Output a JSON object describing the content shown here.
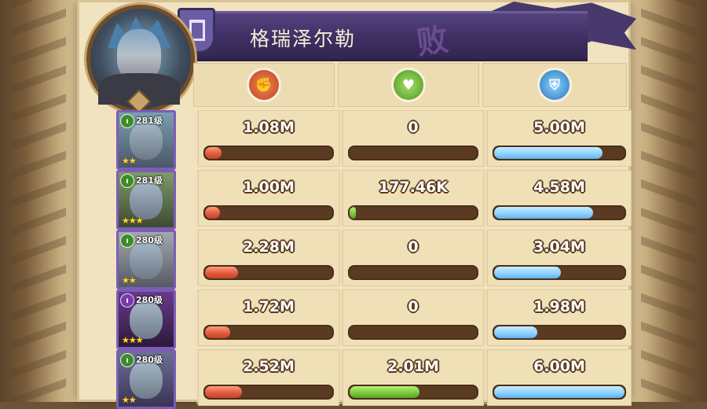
{
  "header": {
    "hero_name": "格瑞泽尔勒",
    "result_stamp": "败"
  },
  "columns": [
    {
      "key": "damage",
      "icon": "damage-icon",
      "color": "#d9583a"
    },
    {
      "key": "healing",
      "icon": "healing-icon",
      "color": "#6fbf2e"
    },
    {
      "key": "damage_taken",
      "icon": "shield-icon",
      "color": "#5fb2f0"
    }
  ],
  "rows": [
    {
      "level": "281级",
      "stars": "★★",
      "faction": "green",
      "damage": {
        "text": "1.08M",
        "fill": 0.13
      },
      "healing": {
        "text": "0",
        "fill": 0
      },
      "damage_taken": {
        "text": "5.00M",
        "fill": 0.83
      }
    },
    {
      "level": "281级",
      "stars": "★★★",
      "faction": "green",
      "damage": {
        "text": "1.00M",
        "fill": 0.12
      },
      "healing": {
        "text": "177.46K",
        "fill": 0.05
      },
      "damage_taken": {
        "text": "4.58M",
        "fill": 0.76
      }
    },
    {
      "level": "280级",
      "stars": "★★",
      "faction": "green",
      "damage": {
        "text": "2.28M",
        "fill": 0.26
      },
      "healing": {
        "text": "0",
        "fill": 0
      },
      "damage_taken": {
        "text": "3.04M",
        "fill": 0.51
      }
    },
    {
      "level": "280级",
      "stars": "★★★",
      "faction": "graveborn",
      "damage": {
        "text": "1.72M",
        "fill": 0.2
      },
      "healing": {
        "text": "0",
        "fill": 0
      },
      "damage_taken": {
        "text": "1.98M",
        "fill": 0.33
      }
    },
    {
      "level": "280级",
      "stars": "★★",
      "faction": "green",
      "damage": {
        "text": "2.52M",
        "fill": 0.29
      },
      "healing": {
        "text": "2.01M",
        "fill": 0.55
      },
      "damage_taken": {
        "text": "6.00M",
        "fill": 1.0
      }
    }
  ]
}
